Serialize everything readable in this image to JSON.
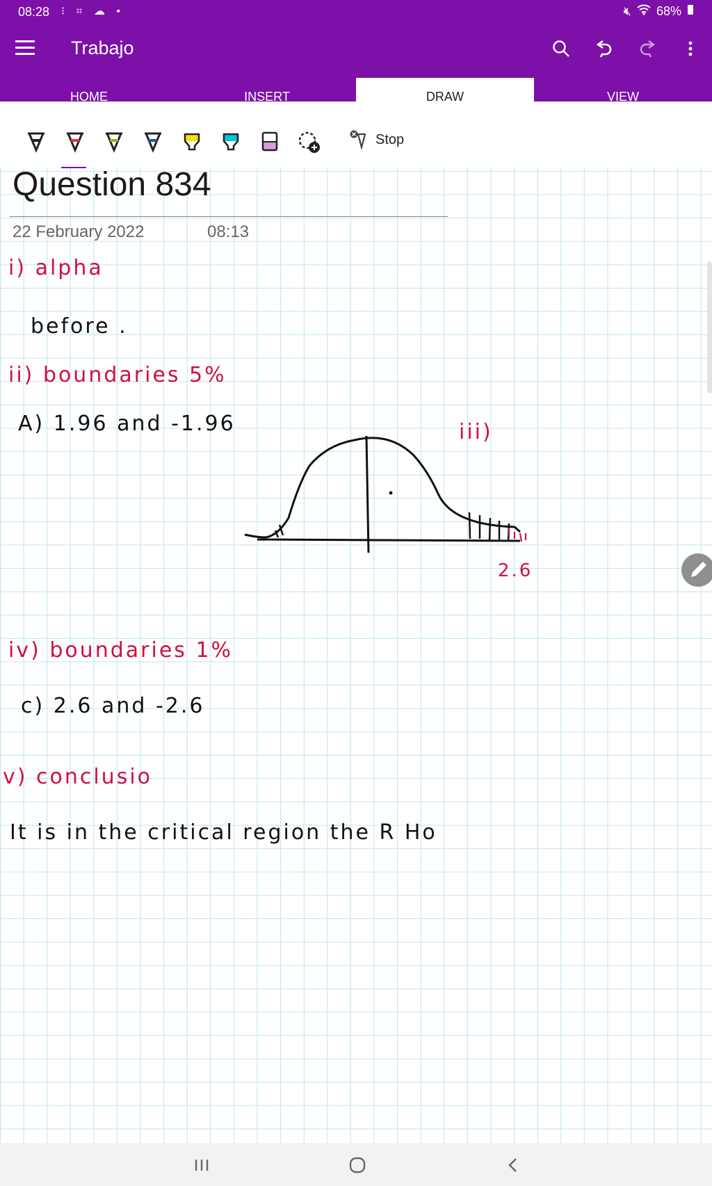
{
  "status": {
    "time": "08:28",
    "battery": "68%"
  },
  "app": {
    "title": "Trabajo"
  },
  "tabs": [
    {
      "label": "HOME"
    },
    {
      "label": "INSERT"
    },
    {
      "label": "DRAW"
    },
    {
      "label": "VIEW"
    }
  ],
  "toolbar": {
    "stop_label": "Stop",
    "pens": [
      "#222222",
      "#e03050",
      "#8ab820",
      "#1f5a96",
      "#f6e200",
      "#00c8e0",
      "#d89ce0"
    ]
  },
  "page": {
    "title": "Question 834",
    "date": "22 February 2022",
    "time": "08:13"
  },
  "ink": [
    {
      "text": "i) alpha",
      "color": "red"
    },
    {
      "text": "before .",
      "color": "black"
    },
    {
      "text": "ii) boundaries 5%",
      "color": "red"
    },
    {
      "text": "A) 1.96 and -1.96",
      "color": "black"
    },
    {
      "text": "iii)",
      "color": "red"
    },
    {
      "text": "2.6",
      "color": "red"
    },
    {
      "text": "iv) boundaries 1%",
      "color": "red"
    },
    {
      "text": "c) 2.6 and -2.6",
      "color": "black"
    },
    {
      "text": "v) conclusio",
      "color": "red"
    },
    {
      "text": "It is in the critical region the R Ho",
      "color": "black"
    }
  ]
}
